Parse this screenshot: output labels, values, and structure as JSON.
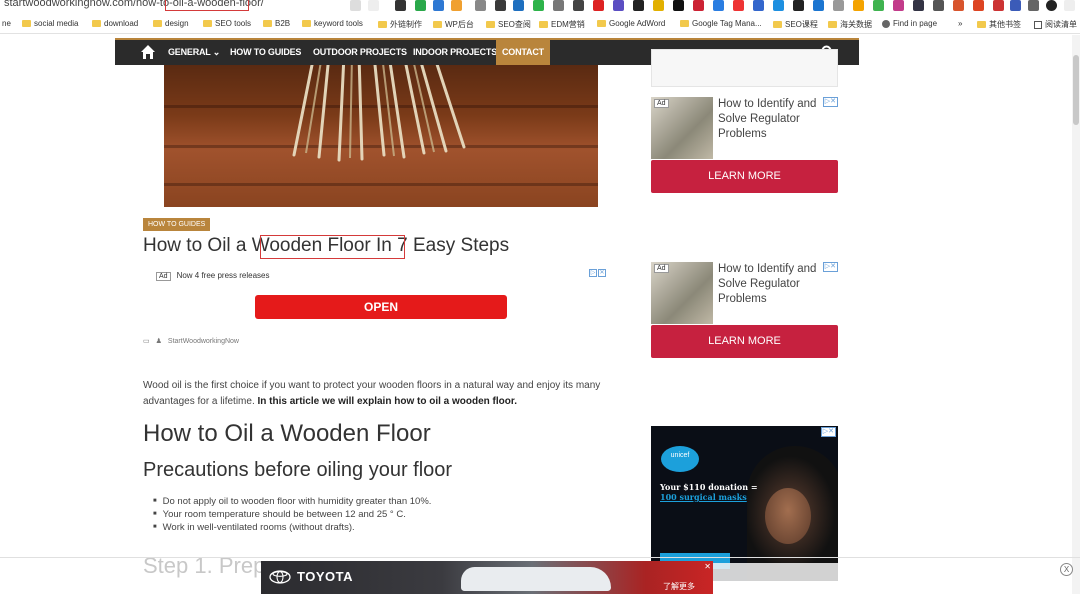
{
  "browser": {
    "url": "startwoodworkingnow.com/how-to-oil-a-wooden-floor/",
    "bookmarks": [
      "ne",
      "social media",
      "download",
      "design",
      "SEO tools",
      "B2B",
      "keyword tools",
      "外链制作",
      "WP后台",
      "SEO查阅",
      "EDM营销",
      "Google AdWord",
      "Google Tag Mana...",
      "SEO课程",
      "海关数据",
      "Find in page",
      "»",
      "其他书签",
      "阅读清单"
    ]
  },
  "nav": {
    "items": [
      {
        "label": "GENERAL ⌄",
        "active": false
      },
      {
        "label": "HOW TO GUIDES",
        "active": false
      },
      {
        "label": "OUTDOOR PROJECTS",
        "active": false
      },
      {
        "label": "INDOOR PROJECTS",
        "active": false
      },
      {
        "label": "CONTACT",
        "active": true
      }
    ],
    "accent_color": "#b9853c"
  },
  "article": {
    "category": "HOW TO GUIDES",
    "title": "How to Oil a Wooden Floor In 7 Easy Steps",
    "ad_label": "Ad",
    "ad_text": "Now 4 free press releases",
    "open_button": "OPEN",
    "author": "StartWoodworkingNow",
    "intro": "Wood oil is the first choice if you want to protect your wooden floors in a natural way and enjoy its many advantages for a lifetime.",
    "intro_bold": "In this article we will explain how to oil a wooden floor.",
    "h2": "How to Oil a Wooden Floor",
    "h3": "Precautions before oiling your floor",
    "bullets": [
      "Do not apply oil to wooden floor with humidity greater than 10%.",
      "Your room temperature should be between 12 and 25 ° C.",
      "Work in well-ventilated rooms (without drafts)."
    ],
    "step_heading": "Step 1. Prep                               r"
  },
  "sidebar": {
    "ads": [
      {
        "tag": "Ad",
        "text": "How to Identify and Solve Regulator Problems",
        "button": "LEARN MORE"
      },
      {
        "tag": "Ad",
        "text": "How to Identify and Solve Regulator Problems",
        "button": "LEARN MORE"
      }
    ],
    "unicef": {
      "logo": "unicef",
      "line1": "Your $110 donation =",
      "line2": "100 surgical masks"
    },
    "ad_color": "#c6213f"
  },
  "bottom_ad": {
    "brand": "TOYOTA",
    "cta": "了解更多",
    "close": "X"
  }
}
